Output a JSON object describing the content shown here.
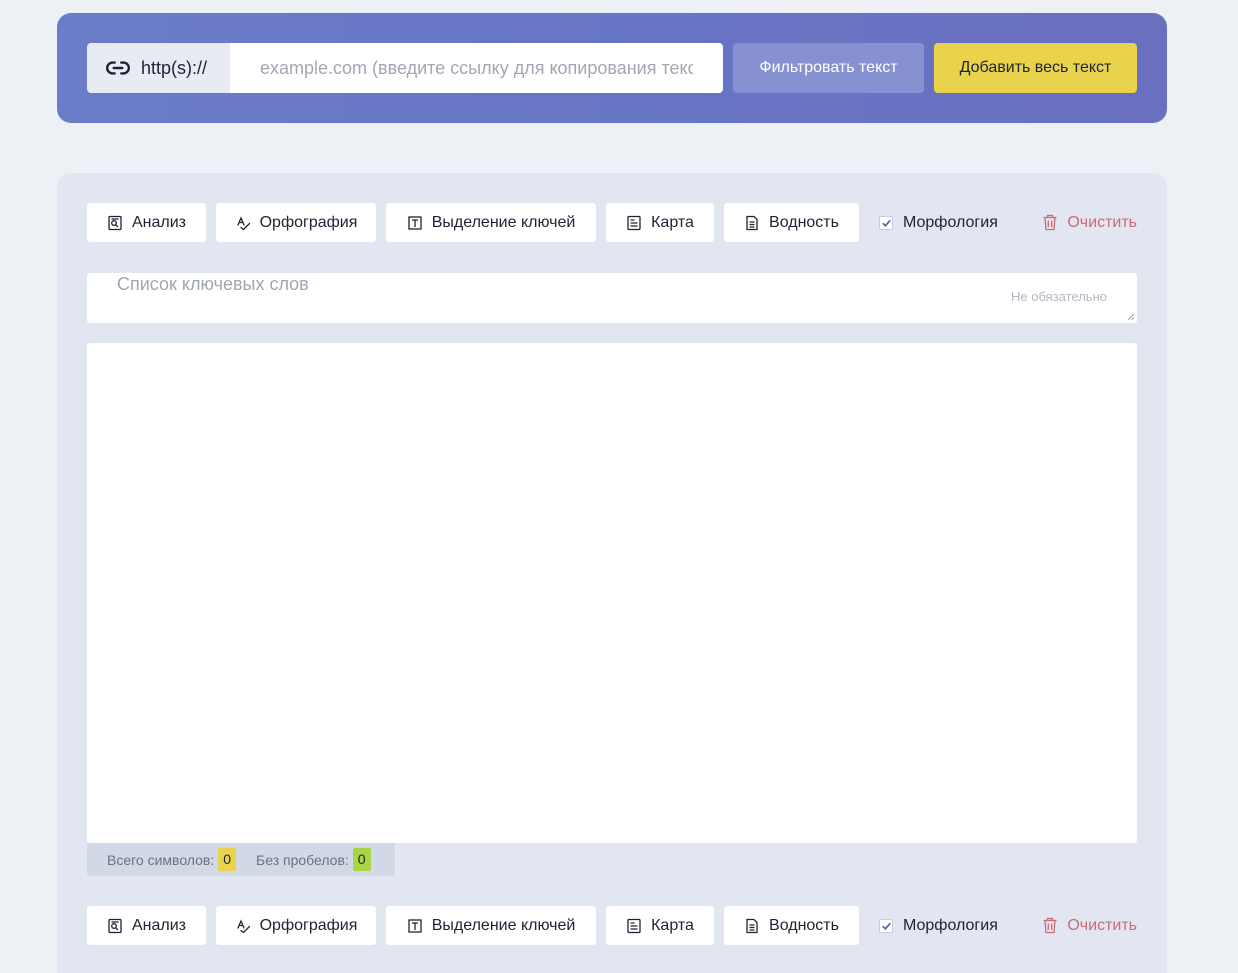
{
  "url_bar": {
    "prefix": "http(s)://",
    "input_placeholder": "example.com (введите ссылку для копирования текста)",
    "input_value": "",
    "filter_button": "Фильтровать текст",
    "add_button": "Добавить весь текст"
  },
  "toolbar": {
    "analysis": "Анализ",
    "spelling": "Орфография",
    "keys": "Выделение ключей",
    "map": "Карта",
    "water": "Водность",
    "morphology": "Морфология",
    "morphology_checked": true,
    "clear": "Очистить"
  },
  "keywords": {
    "placeholder": "Список ключевых слов",
    "optional_hint": "Не обязательно"
  },
  "counters": {
    "total_label": "Всего символов:",
    "total_value": "0",
    "no_spaces_label": "Без пробелов:",
    "no_spaces_value": "0"
  },
  "colors": {
    "url_panel": "#6775c4",
    "filter_button": "#8791d1",
    "add_button": "#ead34c",
    "clear_text": "#cc6a74",
    "badge_green": "#a7d544"
  }
}
